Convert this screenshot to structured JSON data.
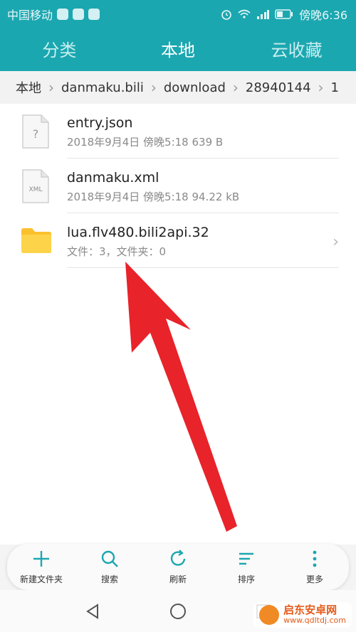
{
  "status_bar": {
    "carrier": "中国移动",
    "time": "傍晚6:36"
  },
  "tabs": [
    {
      "label": "分类",
      "active": false
    },
    {
      "label": "本地",
      "active": true
    },
    {
      "label": "云收藏",
      "active": false
    }
  ],
  "breadcrumb": [
    "本地",
    "danmaku.bili",
    "download",
    "28940144",
    "1"
  ],
  "files": [
    {
      "name": "entry.json",
      "meta": "2018年9月4日 傍晚5:18 639 B",
      "icon": "file-unknown-icon",
      "icon_text": "?"
    },
    {
      "name": "danmaku.xml",
      "meta": "2018年9月4日 傍晚5:18 94.22 kB",
      "icon": "file-xml-icon",
      "icon_text": "XML"
    },
    {
      "name": "lua.flv480.bili2api.32",
      "meta": "文件：3，文件夹：0",
      "icon": "folder-icon",
      "icon_text": ""
    }
  ],
  "toolbar": [
    {
      "label": "新建文件夹",
      "icon": "plus-icon"
    },
    {
      "label": "搜索",
      "icon": "search-icon"
    },
    {
      "label": "刷新",
      "icon": "refresh-icon"
    },
    {
      "label": "排序",
      "icon": "sort-icon"
    },
    {
      "label": "更多",
      "icon": "more-icon"
    }
  ],
  "watermark": {
    "title": "启东安卓网",
    "url": "www.qdltdj.com"
  },
  "colors": {
    "accent": "#1ba7b0",
    "arrow": "#e8232a",
    "folder": "#fbc02d"
  }
}
